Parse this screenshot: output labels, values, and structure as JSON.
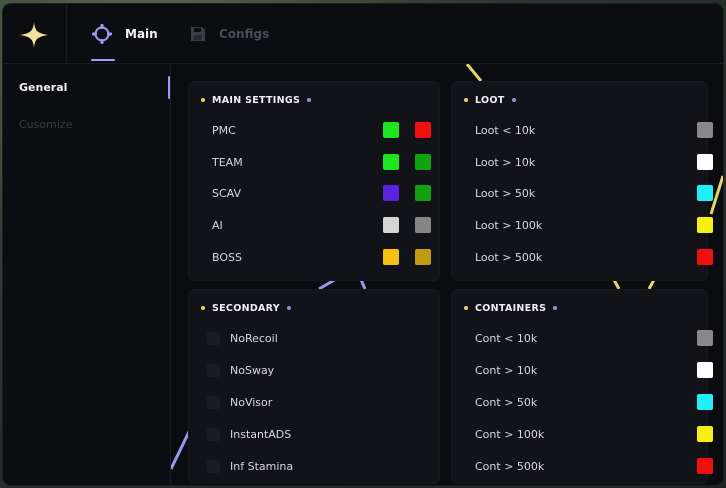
{
  "nav": {
    "tabs": [
      {
        "label": "Main",
        "icon": "crosshair-icon"
      },
      {
        "label": "Configs",
        "icon": "save-icon"
      }
    ],
    "logo_icon": "sparkle-icon"
  },
  "sidebar": {
    "items": [
      {
        "label": "General"
      },
      {
        "label": "Cusomize"
      }
    ]
  },
  "panels": {
    "main_settings": {
      "title": "MAIN SETTINGS",
      "rows": [
        {
          "label": "PMC",
          "colors": [
            "#1ee51e",
            "#ee0f0f"
          ]
        },
        {
          "label": "TEAM",
          "colors": [
            "#1ee51e",
            "#11a211"
          ]
        },
        {
          "label": "SCAV",
          "colors": [
            "#5a22dd",
            "#12a010"
          ]
        },
        {
          "label": "AI",
          "colors": [
            "#d4d4d4",
            "#858585"
          ]
        },
        {
          "label": "BOSS",
          "colors": [
            "#f5c012",
            "#bf9c12"
          ]
        }
      ]
    },
    "loot": {
      "title": "LOOT",
      "rows": [
        {
          "label": "Loot < 10k",
          "color": "#888888"
        },
        {
          "label": "Loot > 10k",
          "color": "#ffffff"
        },
        {
          "label": "Loot > 50k",
          "color": "#1ff0f8"
        },
        {
          "label": "Loot > 100k",
          "color": "#f5f012"
        },
        {
          "label": "Loot > 500k",
          "color": "#ee0f0f"
        }
      ]
    },
    "secondary": {
      "title": "SECONDARY",
      "rows": [
        {
          "label": "NoRecoil"
        },
        {
          "label": "NoSway"
        },
        {
          "label": "NoVisor"
        },
        {
          "label": "InstantADS"
        },
        {
          "label": "Inf Stamina"
        }
      ]
    },
    "containers": {
      "title": "CONTAINERS",
      "rows": [
        {
          "label": "Cont < 10k",
          "color": "#888888"
        },
        {
          "label": "Cont > 10k",
          "color": "#ffffff"
        },
        {
          "label": "Cont > 50k",
          "color": "#1ff0f8"
        },
        {
          "label": "Cont > 100k",
          "color": "#f5f012"
        },
        {
          "label": "Cont > 500k",
          "color": "#ee0f0f"
        }
      ]
    }
  },
  "theme": {
    "accent": "#9d9df5",
    "title_dot": "#e6d36b",
    "title_dot_secondary": "#8f8fe0"
  }
}
